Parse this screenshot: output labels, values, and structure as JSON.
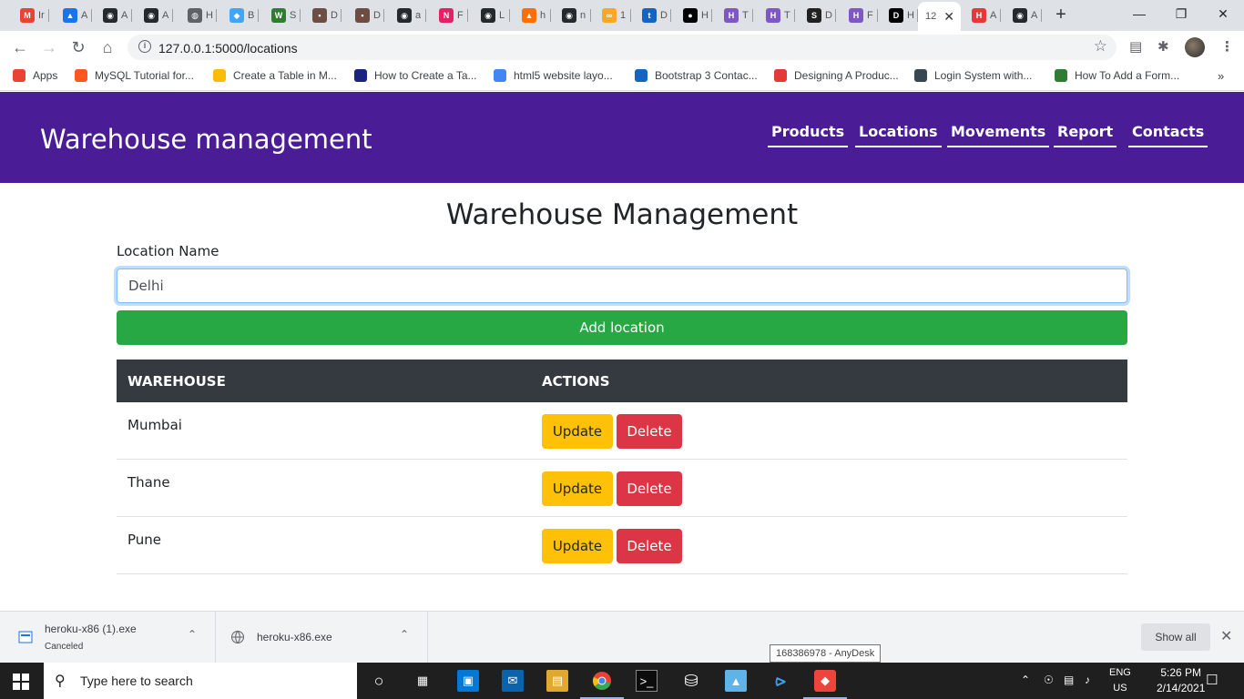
{
  "browser": {
    "tabs": [
      {
        "label": "Ir",
        "color": "#ea4335",
        "glyph": "M"
      },
      {
        "label": "A",
        "color": "#1a73e8",
        "glyph": "▲"
      },
      {
        "label": "A",
        "color": "#24292e",
        "glyph": "◉"
      },
      {
        "label": "A",
        "color": "#24292e",
        "glyph": "◉"
      },
      {
        "label": "H",
        "color": "#5f6368",
        "glyph": "◍"
      },
      {
        "label": "B",
        "color": "#42a5f5",
        "glyph": "◆"
      },
      {
        "label": "S",
        "color": "#2e7d32",
        "glyph": "W"
      },
      {
        "label": "D",
        "color": "#6d4c41",
        "glyph": "▪"
      },
      {
        "label": "D",
        "color": "#6d4c41",
        "glyph": "▪"
      },
      {
        "label": "a",
        "color": "#24292e",
        "glyph": "◉"
      },
      {
        "label": "F",
        "color": "#e91e63",
        "glyph": "N"
      },
      {
        "label": "L",
        "color": "#24292e",
        "glyph": "◉"
      },
      {
        "label": "h",
        "color": "#ff6f00",
        "glyph": "▲"
      },
      {
        "label": "n",
        "color": "#24292e",
        "glyph": "◉"
      },
      {
        "label": "1",
        "color": "#f9a825",
        "glyph": "∞"
      },
      {
        "label": "D",
        "color": "#1565c0",
        "glyph": "t"
      },
      {
        "label": "H",
        "color": "#000000",
        "glyph": "●"
      },
      {
        "label": "T",
        "color": "#7e57c2",
        "glyph": "H"
      },
      {
        "label": "T",
        "color": "#7e57c2",
        "glyph": "H"
      },
      {
        "label": "D",
        "color": "#212121",
        "glyph": "S"
      },
      {
        "label": "F",
        "color": "#7e57c2",
        "glyph": "H"
      },
      {
        "label": "H",
        "color": "#000000",
        "glyph": "D"
      },
      {
        "label": "12",
        "color": "#ffffff",
        "glyph": ""
      },
      {
        "label": "A",
        "color": "#e53935",
        "glyph": "H"
      },
      {
        "label": "A",
        "color": "#24292e",
        "glyph": "◉"
      }
    ],
    "url": "127.0.0.1:5000/locations",
    "bookmarks": [
      {
        "label": "Apps",
        "color": "#ea4335"
      },
      {
        "label": "MySQL Tutorial for...",
        "color": "#ff5722"
      },
      {
        "label": "Create a Table in M...",
        "color": "#fbbc05"
      },
      {
        "label": "How to Create a Ta...",
        "color": "#1a237e"
      },
      {
        "label": "html5 website layo...",
        "color": "#4285f4"
      },
      {
        "label": "Bootstrap 3 Contac...",
        "color": "#1565c0"
      },
      {
        "label": "Designing A Produc...",
        "color": "#e53935"
      },
      {
        "label": "Login System with...",
        "color": "#37474f"
      },
      {
        "label": "How To Add a Form...",
        "color": "#2e7d32"
      }
    ]
  },
  "app": {
    "brand": "Warehouse management",
    "nav": [
      "Products",
      "Locations",
      "Movements",
      "Report",
      "Contacts"
    ],
    "colors": {
      "header": "#4a1c96",
      "add": "#28a745",
      "update": "#ffc107",
      "delete": "#dc3545",
      "thead": "#343a40"
    }
  },
  "main": {
    "title": "Warehouse Management",
    "label": "Location Name",
    "input_value": "Delhi",
    "add_label": "Add location",
    "headers": [
      "WAREHOUSE",
      "ACTIONS"
    ],
    "rows": [
      {
        "name": "Mumbai",
        "update": "Update",
        "delete": "Delete"
      },
      {
        "name": "Thane",
        "update": "Update",
        "delete": "Delete"
      },
      {
        "name": "Pune",
        "update": "Update",
        "delete": "Delete"
      }
    ]
  },
  "downloads": {
    "items": [
      {
        "name": "heroku-x86 (1).exe",
        "status": "Canceled"
      },
      {
        "name": "heroku-x86.exe",
        "status": ""
      }
    ],
    "show_all": "Show all",
    "tooltip": "168386978 - AnyDesk"
  },
  "taskbar": {
    "search_placeholder": "Type here to search",
    "lang": "ENG",
    "region": "US",
    "time": "5:26 PM",
    "date": "2/14/2021"
  }
}
